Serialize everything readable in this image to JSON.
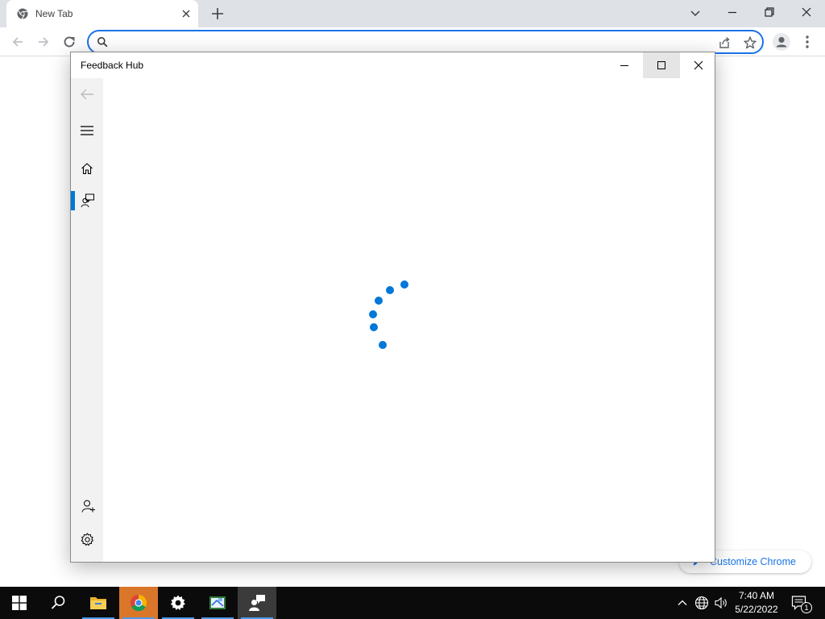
{
  "browser": {
    "tab": {
      "title": "New Tab",
      "favicon": "chrome-icon"
    },
    "toolbar": {
      "omnibox_value": "",
      "icons": [
        "back-icon",
        "forward-icon",
        "reload-icon",
        "search-icon",
        "share-icon",
        "bookmark-star-icon",
        "profile-icon",
        "menu-icon"
      ]
    },
    "customize_chip": {
      "label": "Customize Chrome",
      "icon": "pencil-icon"
    },
    "accent": "#1a73e8"
  },
  "feedback_hub": {
    "title": "Feedback Hub",
    "nav_icons": [
      "back-icon",
      "hamburger-icon",
      "home-icon",
      "feedback-icon",
      "add-user-icon",
      "settings-icon"
    ],
    "selected_nav": "feedback",
    "state": "loading",
    "accent": "#0078d7"
  },
  "taskbar": {
    "apps": [
      "file-explorer",
      "google-chrome",
      "settings",
      "snipping-tool",
      "feedback-hub"
    ],
    "active_app": "feedback-hub",
    "clock": {
      "time": "7:40 AM",
      "date": "5/22/2022"
    },
    "notification_count": "1"
  }
}
